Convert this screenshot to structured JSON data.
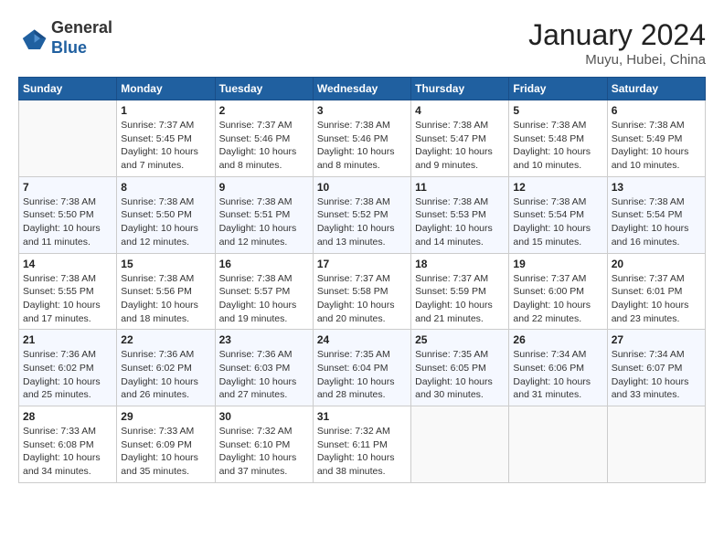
{
  "header": {
    "logo_general": "General",
    "logo_blue": "Blue",
    "title": "January 2024",
    "subtitle": "Muyu, Hubei, China"
  },
  "columns": [
    "Sunday",
    "Monday",
    "Tuesday",
    "Wednesday",
    "Thursday",
    "Friday",
    "Saturday"
  ],
  "weeks": [
    [
      {
        "day": "",
        "info": ""
      },
      {
        "day": "1",
        "info": "Sunrise: 7:37 AM\nSunset: 5:45 PM\nDaylight: 10 hours\nand 7 minutes."
      },
      {
        "day": "2",
        "info": "Sunrise: 7:37 AM\nSunset: 5:46 PM\nDaylight: 10 hours\nand 8 minutes."
      },
      {
        "day": "3",
        "info": "Sunrise: 7:38 AM\nSunset: 5:46 PM\nDaylight: 10 hours\nand 8 minutes."
      },
      {
        "day": "4",
        "info": "Sunrise: 7:38 AM\nSunset: 5:47 PM\nDaylight: 10 hours\nand 9 minutes."
      },
      {
        "day": "5",
        "info": "Sunrise: 7:38 AM\nSunset: 5:48 PM\nDaylight: 10 hours\nand 10 minutes."
      },
      {
        "day": "6",
        "info": "Sunrise: 7:38 AM\nSunset: 5:49 PM\nDaylight: 10 hours\nand 10 minutes."
      }
    ],
    [
      {
        "day": "7",
        "info": "Sunrise: 7:38 AM\nSunset: 5:50 PM\nDaylight: 10 hours\nand 11 minutes."
      },
      {
        "day": "8",
        "info": "Sunrise: 7:38 AM\nSunset: 5:50 PM\nDaylight: 10 hours\nand 12 minutes."
      },
      {
        "day": "9",
        "info": "Sunrise: 7:38 AM\nSunset: 5:51 PM\nDaylight: 10 hours\nand 12 minutes."
      },
      {
        "day": "10",
        "info": "Sunrise: 7:38 AM\nSunset: 5:52 PM\nDaylight: 10 hours\nand 13 minutes."
      },
      {
        "day": "11",
        "info": "Sunrise: 7:38 AM\nSunset: 5:53 PM\nDaylight: 10 hours\nand 14 minutes."
      },
      {
        "day": "12",
        "info": "Sunrise: 7:38 AM\nSunset: 5:54 PM\nDaylight: 10 hours\nand 15 minutes."
      },
      {
        "day": "13",
        "info": "Sunrise: 7:38 AM\nSunset: 5:54 PM\nDaylight: 10 hours\nand 16 minutes."
      }
    ],
    [
      {
        "day": "14",
        "info": "Sunrise: 7:38 AM\nSunset: 5:55 PM\nDaylight: 10 hours\nand 17 minutes."
      },
      {
        "day": "15",
        "info": "Sunrise: 7:38 AM\nSunset: 5:56 PM\nDaylight: 10 hours\nand 18 minutes."
      },
      {
        "day": "16",
        "info": "Sunrise: 7:38 AM\nSunset: 5:57 PM\nDaylight: 10 hours\nand 19 minutes."
      },
      {
        "day": "17",
        "info": "Sunrise: 7:37 AM\nSunset: 5:58 PM\nDaylight: 10 hours\nand 20 minutes."
      },
      {
        "day": "18",
        "info": "Sunrise: 7:37 AM\nSunset: 5:59 PM\nDaylight: 10 hours\nand 21 minutes."
      },
      {
        "day": "19",
        "info": "Sunrise: 7:37 AM\nSunset: 6:00 PM\nDaylight: 10 hours\nand 22 minutes."
      },
      {
        "day": "20",
        "info": "Sunrise: 7:37 AM\nSunset: 6:01 PM\nDaylight: 10 hours\nand 23 minutes."
      }
    ],
    [
      {
        "day": "21",
        "info": "Sunrise: 7:36 AM\nSunset: 6:02 PM\nDaylight: 10 hours\nand 25 minutes."
      },
      {
        "day": "22",
        "info": "Sunrise: 7:36 AM\nSunset: 6:02 PM\nDaylight: 10 hours\nand 26 minutes."
      },
      {
        "day": "23",
        "info": "Sunrise: 7:36 AM\nSunset: 6:03 PM\nDaylight: 10 hours\nand 27 minutes."
      },
      {
        "day": "24",
        "info": "Sunrise: 7:35 AM\nSunset: 6:04 PM\nDaylight: 10 hours\nand 28 minutes."
      },
      {
        "day": "25",
        "info": "Sunrise: 7:35 AM\nSunset: 6:05 PM\nDaylight: 10 hours\nand 30 minutes."
      },
      {
        "day": "26",
        "info": "Sunrise: 7:34 AM\nSunset: 6:06 PM\nDaylight: 10 hours\nand 31 minutes."
      },
      {
        "day": "27",
        "info": "Sunrise: 7:34 AM\nSunset: 6:07 PM\nDaylight: 10 hours\nand 33 minutes."
      }
    ],
    [
      {
        "day": "28",
        "info": "Sunrise: 7:33 AM\nSunset: 6:08 PM\nDaylight: 10 hours\nand 34 minutes."
      },
      {
        "day": "29",
        "info": "Sunrise: 7:33 AM\nSunset: 6:09 PM\nDaylight: 10 hours\nand 35 minutes."
      },
      {
        "day": "30",
        "info": "Sunrise: 7:32 AM\nSunset: 6:10 PM\nDaylight: 10 hours\nand 37 minutes."
      },
      {
        "day": "31",
        "info": "Sunrise: 7:32 AM\nSunset: 6:11 PM\nDaylight: 10 hours\nand 38 minutes."
      },
      {
        "day": "",
        "info": ""
      },
      {
        "day": "",
        "info": ""
      },
      {
        "day": "",
        "info": ""
      }
    ]
  ]
}
